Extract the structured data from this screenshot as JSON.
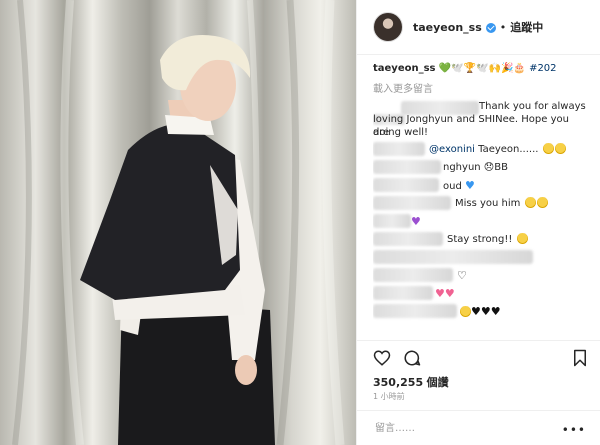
{
  "photo": {
    "alt_name": "post-photo"
  },
  "header": {
    "username": "taeyeon_ss",
    "dot": "•",
    "follow_label": "追蹤中"
  },
  "caption": {
    "username": "taeyeon_ss",
    "emojis": "💚🕊️🏆🕊️🙌🎉🎂",
    "hashtag": "#202"
  },
  "load_more": "載入更多留言",
  "comments": [
    {
      "text_1": "Thank you for always",
      "text_2": "loving Jonghyun and SHINee. Hope you are",
      "text_3": "doing well!"
    },
    {
      "mention": "@exonini",
      "text": " Taeyeon......"
    },
    {
      "text": "nghyun 😞BB"
    },
    {
      "text": "oud"
    },
    {
      "text": "Miss you him"
    },
    {
      "text": ""
    },
    {
      "text": "Stay strong!!"
    },
    {
      "text": ""
    },
    {
      "text": ""
    },
    {
      "text": ""
    },
    {
      "text": ""
    }
  ],
  "likes": {
    "count": "350,255",
    "unit": "個讚"
  },
  "time": "1 小時前",
  "add_comment_placeholder": "留言……",
  "more_label": "•••",
  "colors": {
    "link": "#003569",
    "verified": "#3897f0",
    "muted": "#999999"
  }
}
